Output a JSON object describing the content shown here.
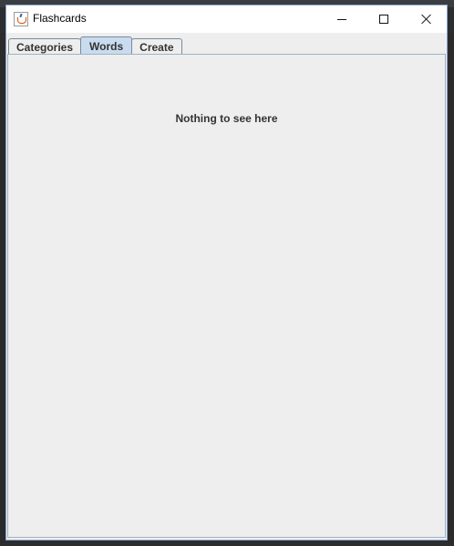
{
  "window": {
    "title": "Flashcards"
  },
  "tabs": [
    {
      "label": "Categories",
      "active": false
    },
    {
      "label": "Words",
      "active": true
    },
    {
      "label": "Create",
      "active": false
    }
  ],
  "content": {
    "empty_message": "Nothing to see here"
  },
  "icons": {
    "app": "java-coffee-cup-icon",
    "minimize": "minimize-icon",
    "maximize": "maximize-icon",
    "close": "close-icon"
  },
  "colors": {
    "active_tab": "#c9dcef",
    "panel_background": "#eeeeee",
    "window_border": "#8aa4c8"
  }
}
